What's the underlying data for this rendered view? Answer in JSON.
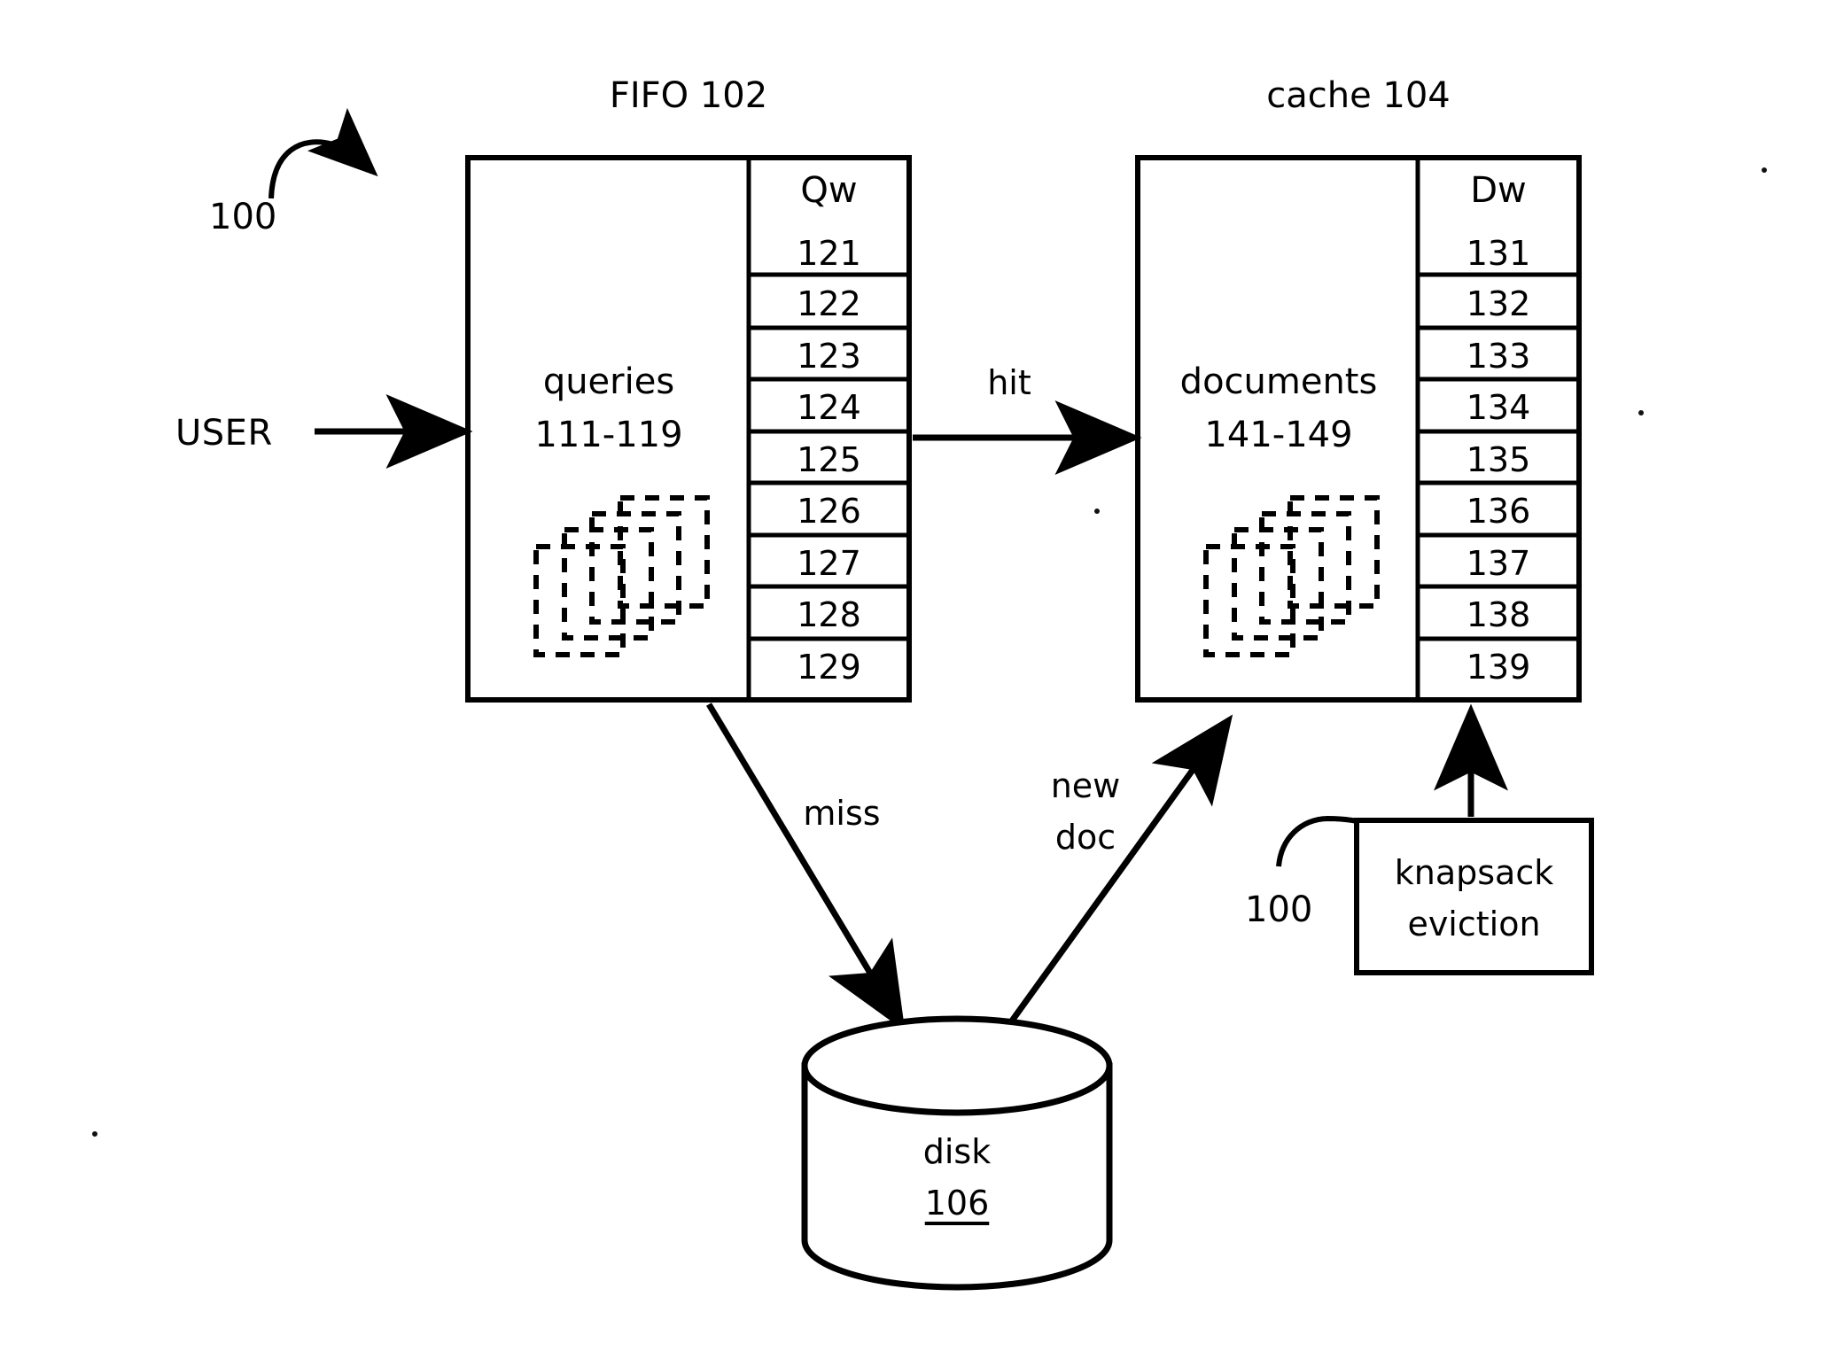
{
  "figure": {
    "reference_numeral_top": "100",
    "reference_numeral_bottom": "100"
  },
  "actor": {
    "label": "USER"
  },
  "fifo": {
    "title": "FIFO 102",
    "body_line1": "queries",
    "body_line2": "111-119",
    "column_header": "Qw",
    "rows": [
      "121",
      "122",
      "123",
      "124",
      "125",
      "126",
      "127",
      "128",
      "129"
    ],
    "doc_stack_name": "query-stack-icon"
  },
  "cache": {
    "title": "cache 104",
    "body_line1": "documents",
    "body_line2": "141-149",
    "column_header": "Dw",
    "rows": [
      "131",
      "132",
      "133",
      "134",
      "135",
      "136",
      "137",
      "138",
      "139"
    ],
    "doc_stack_name": "document-stack-icon"
  },
  "disk": {
    "label": "disk",
    "numeral": "106"
  },
  "eviction": {
    "line1": "knapsack",
    "line2": "eviction"
  },
  "edges": {
    "user_to_fifo": "",
    "hit": "hit",
    "miss": "miss",
    "new_doc_line1": "new",
    "new_doc_line2": "doc"
  },
  "colors": {
    "stroke": "#000000",
    "background": "#ffffff"
  }
}
